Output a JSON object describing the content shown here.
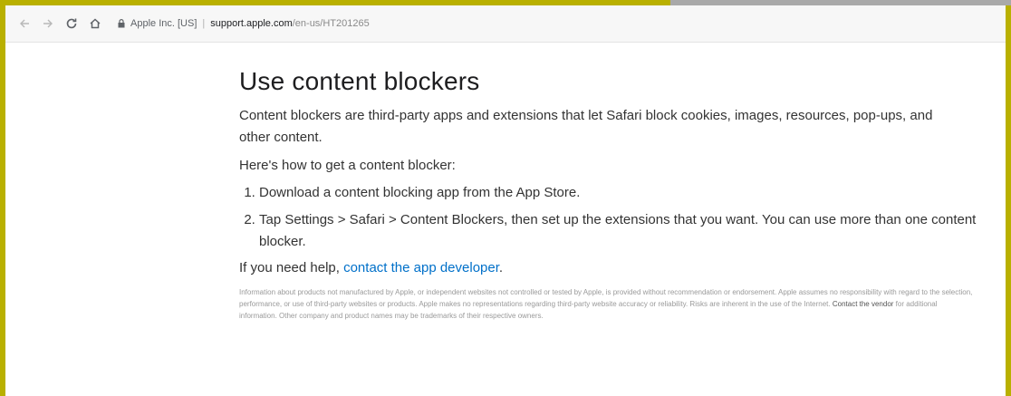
{
  "browser": {
    "back_icon": "arrow-left-icon",
    "forward_icon": "arrow-right-icon",
    "reload_icon": "reload-icon",
    "home_icon": "home-icon",
    "lock_icon": "lock-icon",
    "site_identity": "Apple Inc. [US]",
    "url_host": "support.apple.com",
    "url_path": "/en-us/HT201265"
  },
  "article": {
    "title": "Use content blockers",
    "intro": "Content blockers are third-party apps and extensions that let Safari block cookies, images, resources, pop-ups, and other content.",
    "howto": "Here's how to get a content blocker:",
    "steps": [
      "Download a content blocking app from the App Store.",
      "Tap Settings > Safari > Content Blockers, then set up the extensions that you want. You can use more than one content blocker."
    ],
    "help_prefix": "If you need help, ",
    "help_link": "contact the app developer",
    "help_suffix": "."
  },
  "disclaimer": {
    "text_before": "Information about products not manufactured by Apple, or independent websites not controlled or tested by Apple, is provided without recommendation or endorsement. Apple assumes no responsibility with regard to the selection, performance, or use of third-party websites or products. Apple makes no representations regarding third-party website accuracy or reliability. Risks are inherent in the use of the Internet. ",
    "link": "Contact the vendor",
    "text_after": " for additional information. Other company and product names may be trademarks of their respective owners."
  },
  "colors": {
    "link": "#0070c9",
    "heading": "#1d1d1f",
    "body_text": "#333333",
    "outer_frame": "#b9b000"
  }
}
